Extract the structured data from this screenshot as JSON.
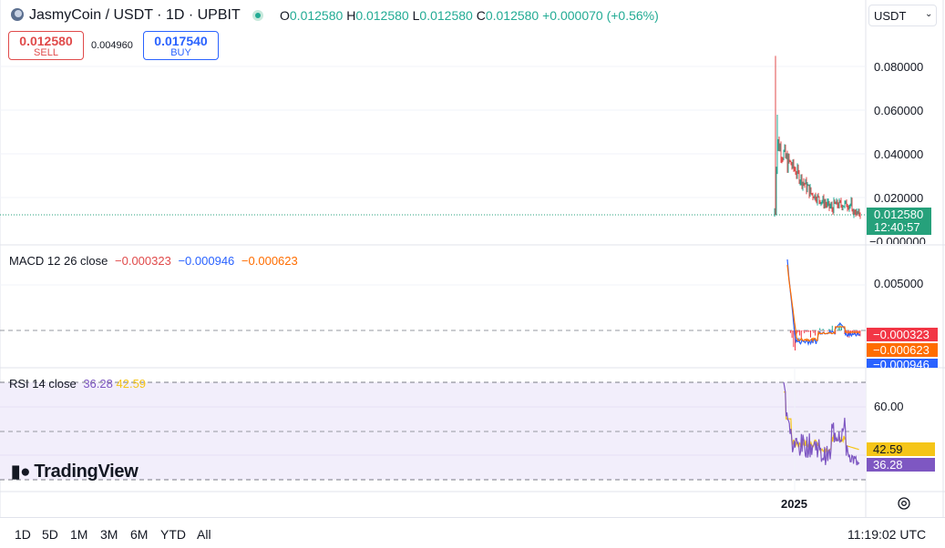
{
  "header": {
    "title": "JasmyCoin / USDT · 1D · UPBIT",
    "ohlc": {
      "o_label": "O",
      "o_value": "0.012580",
      "h_label": "H",
      "h_value": "0.012580",
      "l_label": "L",
      "l_value": "0.012580",
      "c_label": "C",
      "c_value": "0.012580",
      "change": "+0.000070 (+0.56%)"
    },
    "currency": "USDT"
  },
  "trade": {
    "sell_price": "0.012580",
    "sell_label": "SELL",
    "spread": "0.004960",
    "buy_price": "0.017540",
    "buy_label": "BUY"
  },
  "price_axis": [
    "0.080000",
    "0.060000",
    "0.040000",
    "0.020000",
    "−0.000000"
  ],
  "price_tag": {
    "price": "0.012580",
    "countdown": "12:40:57"
  },
  "macd": {
    "legend": "MACD 12 26 close",
    "v1": "−0.000323",
    "v2": "−0.000946",
    "v3": "−0.000623",
    "axis": [
      "0.005000"
    ],
    "tags": [
      "−0.000323",
      "−0.000623",
      "−0.000946"
    ]
  },
  "rsi": {
    "legend": "RSI 14 close",
    "v1": "36.28",
    "v2": "42.59",
    "axis": [
      "60.00"
    ],
    "tags": [
      "42.59",
      "36.28"
    ]
  },
  "time_axis": {
    "year": "2025"
  },
  "logo": "TradingView",
  "ranges": [
    "1D",
    "5D",
    "1M",
    "3M",
    "6M",
    "YTD",
    "All"
  ],
  "clock": "11:19:02 UTC",
  "colors": {
    "up": "#22ab94",
    "down": "#e04a4a",
    "macd": "#2962ff",
    "signal": "#ff6d00",
    "rsi": "#7e57c2",
    "rsi_ma": "#f5c518"
  }
}
